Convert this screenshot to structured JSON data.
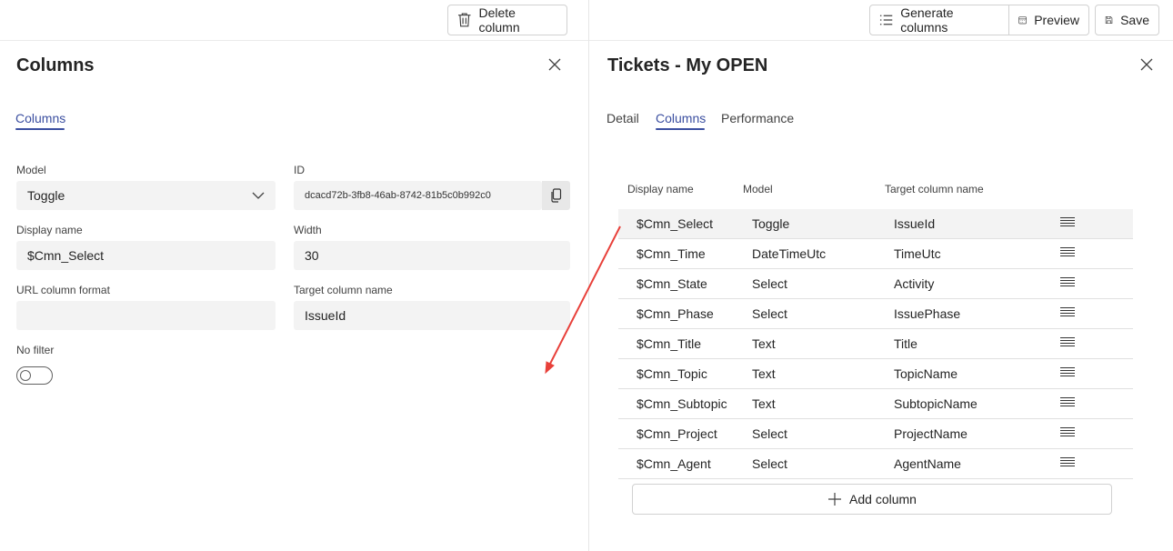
{
  "left": {
    "toolbar": {
      "delete_label": "Delete column"
    },
    "title": "Columns",
    "tabs": [
      {
        "label": "Columns"
      }
    ],
    "form": {
      "model_label": "Model",
      "model_value": "Toggle",
      "id_label": "ID",
      "id_value": "dcacd72b-3fb8-46ab-8742-81b5c0b992c0",
      "display_name_label": "Display name",
      "display_name_value": "$Cmn_Select",
      "width_label": "Width",
      "width_value": "30",
      "url_format_label": "URL column format",
      "url_format_value": "",
      "target_label": "Target column name",
      "target_value": "IssueId",
      "no_filter_label": "No filter",
      "no_filter_on": false
    }
  },
  "right": {
    "toolbar": {
      "generate_label": "Generate columns",
      "preview_label": "Preview",
      "save_label": "Save"
    },
    "title": "Tickets - My OPEN",
    "tabs": [
      {
        "label": "Detail"
      },
      {
        "label": "Columns",
        "active": true
      },
      {
        "label": "Performance"
      }
    ],
    "table": {
      "headers": [
        "Display name",
        "Model",
        "Target column name"
      ],
      "rows": [
        {
          "display": "$Cmn_Select",
          "model": "Toggle",
          "target": "IssueId",
          "selected": true
        },
        {
          "display": "$Cmn_Time",
          "model": "DateTimeUtc",
          "target": "TimeUtc"
        },
        {
          "display": "$Cmn_State",
          "model": "Select",
          "target": "Activity"
        },
        {
          "display": "$Cmn_Phase",
          "model": "Select",
          "target": "IssuePhase"
        },
        {
          "display": "$Cmn_Title",
          "model": "Text",
          "target": "Title"
        },
        {
          "display": "$Cmn_Topic",
          "model": "Text",
          "target": "TopicName"
        },
        {
          "display": "$Cmn_Subtopic",
          "model": "Text",
          "target": "SubtopicName"
        },
        {
          "display": "$Cmn_Project",
          "model": "Select",
          "target": "ProjectName"
        },
        {
          "display": "$Cmn_Agent",
          "model": "Select",
          "target": "AgentName"
        }
      ]
    },
    "add_column_label": "Add column"
  },
  "colors": {
    "accent": "#3b4fa0",
    "annotation_arrow": "#e8403a"
  },
  "icons": [
    "trash-icon",
    "close-icon",
    "chevron-down-icon",
    "copy-icon",
    "list-icon",
    "calendar-icon",
    "save-icon",
    "drag-handle-icon",
    "plus-icon"
  ]
}
